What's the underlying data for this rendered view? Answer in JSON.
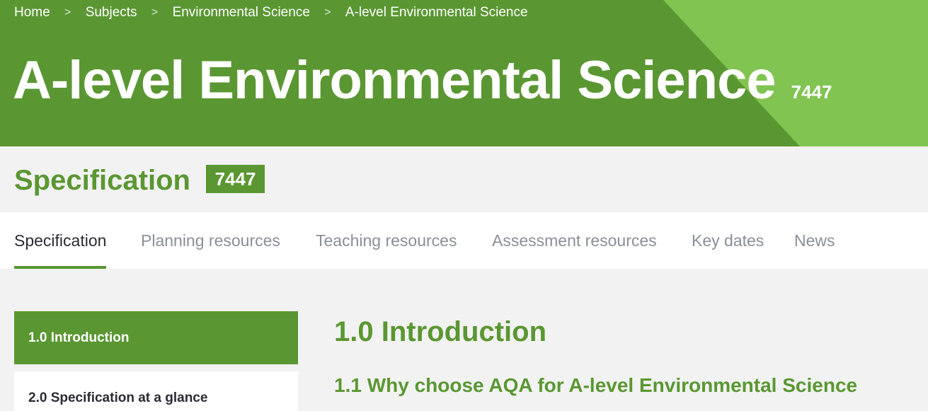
{
  "breadcrumb": {
    "items": [
      "Home",
      "Subjects",
      "Environmental Science",
      "A-level Environmental Science"
    ],
    "separator": ">"
  },
  "hero": {
    "title": "A-level Environmental Science",
    "code": "7447"
  },
  "spec_section": {
    "title": "Specification",
    "code": "7447"
  },
  "tabs": [
    {
      "label": "Specification",
      "active": true
    },
    {
      "label": "Planning resources",
      "active": false
    },
    {
      "label": "Teaching resources",
      "active": false
    },
    {
      "label": "Assessment resources",
      "active": false
    },
    {
      "label": "Key dates",
      "active": false
    },
    {
      "label": "News",
      "active": false
    }
  ],
  "sidebar": {
    "items": [
      {
        "label": "1.0 Introduction",
        "active": true
      },
      {
        "label": "2.0 Specification at a glance",
        "active": false
      }
    ]
  },
  "content": {
    "heading": "1.0 Introduction",
    "subheading": "1.1 Why choose AQA for A-level Environmental Science"
  },
  "colors": {
    "brand_green": "#5a9732",
    "accent_light_green": "#82c452",
    "page_background": "#f2f2f2",
    "inactive_tab_text": "#8a8f98"
  }
}
